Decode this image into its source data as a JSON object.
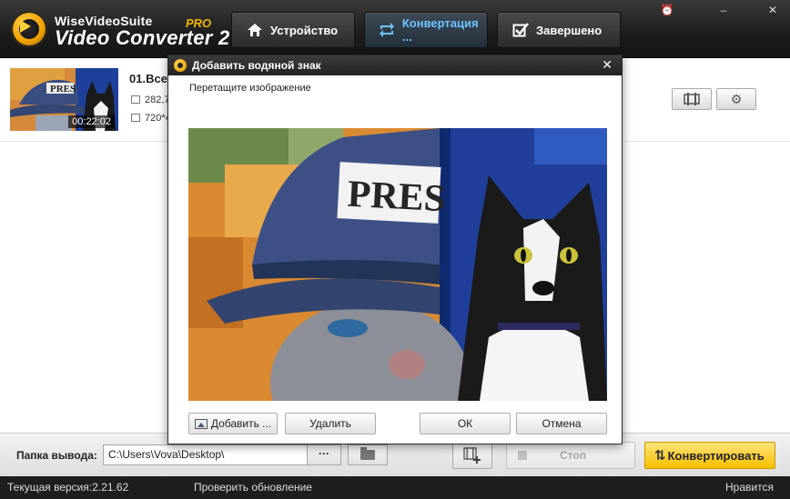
{
  "brand": {
    "line1": "WiseVideoSuite",
    "line2": "Video Converter 2",
    "pro": "PRO"
  },
  "nav": {
    "device": {
      "label": "Устройство",
      "icon": "home-icon"
    },
    "convert": {
      "label": "Конвертация ...",
      "icon": "convert-arrows-icon"
    },
    "done": {
      "label": "Завершено",
      "icon": "checkbox-icon"
    }
  },
  "window_controls": [
    "alarm-icon",
    "minimize-icon",
    "close-icon"
  ],
  "file": {
    "name": "01.Всех",
    "size": "282,7",
    "resolution": "720*4",
    "duration": "00:22:02",
    "thumb_text": "PRES"
  },
  "dialog": {
    "title": "Добавить водяной знак",
    "hint": "Перетащите изображение",
    "preview_text": "PRES",
    "buttons": {
      "add": "Добавить ...",
      "remove": "Удалить",
      "ok": "ОК",
      "cancel": "Отмена"
    }
  },
  "output": {
    "label": "Папка вывода:",
    "path": "C:\\Users\\Vova\\Desktop\\",
    "more": "···"
  },
  "actions": {
    "stop": "Стоп",
    "convert": "Конвертировать"
  },
  "status": {
    "version": "Текущая версия:2.21.62",
    "check_update": "Проверить обновление",
    "like": "Нравится"
  },
  "colors": {
    "accent": "#f7c000",
    "active_tab_text": "#6ec3ff",
    "topbar": "#1c1c1c"
  }
}
